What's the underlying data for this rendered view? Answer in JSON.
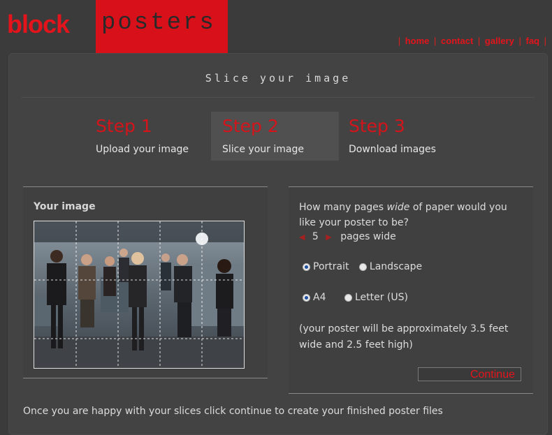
{
  "logo": {
    "block": "block",
    "posters": "posters"
  },
  "nav": {
    "items": [
      "home",
      "contact",
      "gallery",
      "faq"
    ]
  },
  "title": "Slice your image",
  "steps": [
    {
      "num": "Step 1",
      "desc": "Upload your image",
      "active": false
    },
    {
      "num": "Step 2",
      "desc": "Slice your image",
      "active": true
    },
    {
      "num": "Step 3",
      "desc": "Download images",
      "active": false
    }
  ],
  "your_image": {
    "title": "Your image"
  },
  "options": {
    "question_pre": "How many pages ",
    "question_em": "wide",
    "question_post": " of paper would you like your poster to be?",
    "pages_value": "5",
    "pages_suffix": "pages wide",
    "orientation": {
      "portrait": "Portrait",
      "landscape": "Landscape",
      "selected": "Portrait"
    },
    "paper": {
      "a4": "A4",
      "letter": "Letter (US)",
      "selected": "A4"
    },
    "estimate": "(your poster will be approximately 3.5 feet wide and 2.5 feet high)",
    "continue_label": "Continue"
  },
  "footer": "Once you are happy with your slices click continue to create your finished poster files",
  "colors": {
    "accent": "#e3141b",
    "background": "#3b3b3b",
    "panel": "#434343"
  }
}
